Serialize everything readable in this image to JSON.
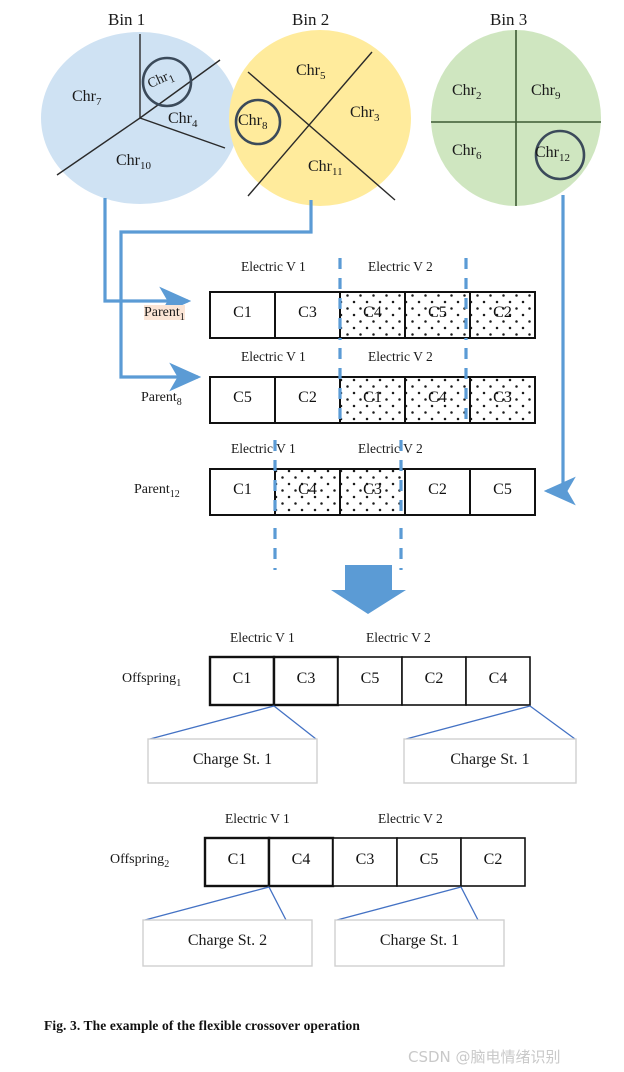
{
  "figure": {
    "caption": "Fig. 3.   The example of the flexible crossover operation",
    "watermark": "CSDN @脑电情绪识别"
  },
  "colors": {
    "bin1_fill": "#cfe2f3",
    "bin2_fill": "#ffeb9c",
    "bin3_fill": "#cfe6c0",
    "sector_line": "#2a2a2a",
    "circle_highlight": "#3b4a5a",
    "arrow_blue": "#5b9bd5",
    "dash_blue": "#5b9bd5",
    "connector_blue": "#4472c4",
    "box_border": "#111111",
    "parent_label_highlight": "#fbe5d6"
  },
  "bins": [
    {
      "name": "Bin 1",
      "shape": "pie-3-sector",
      "chromosomes": [
        {
          "label": "Chr",
          "sub": "7",
          "highlighted": false
        },
        {
          "label": "Chr",
          "sub": "1",
          "highlighted": true
        },
        {
          "label": "Chr",
          "sub": "4",
          "highlighted": false
        },
        {
          "label": "Chr",
          "sub": "10",
          "highlighted": false
        }
      ]
    },
    {
      "name": "Bin 2",
      "shape": "pie-4-sector-cross",
      "chromosomes": [
        {
          "label": "Chr",
          "sub": "5",
          "highlighted": false
        },
        {
          "label": "Chr",
          "sub": "3",
          "highlighted": false
        },
        {
          "label": "Chr",
          "sub": "8",
          "highlighted": true
        },
        {
          "label": "Chr",
          "sub": "11",
          "highlighted": false
        }
      ]
    },
    {
      "name": "Bin 3",
      "shape": "pie-4-quadrant",
      "chromosomes": [
        {
          "label": "Chr",
          "sub": "2",
          "highlighted": false
        },
        {
          "label": "Chr",
          "sub": "9",
          "highlighted": false
        },
        {
          "label": "Chr",
          "sub": "6",
          "highlighted": false
        },
        {
          "label": "Chr",
          "sub": "12",
          "highlighted": true
        }
      ]
    }
  ],
  "ev_labels": {
    "v1": "Electric V 1",
    "v2": "Electric V 2"
  },
  "parents": [
    {
      "name": "Parent",
      "sub": "1",
      "highlight_name": true,
      "cells": [
        {
          "text": "C1",
          "pattern": "plain"
        },
        {
          "text": "C3",
          "pattern": "plain"
        },
        {
          "text": "C4",
          "pattern": "dotted"
        },
        {
          "text": "C5",
          "pattern": "dotted"
        },
        {
          "text": "C2",
          "pattern": "dotted"
        }
      ]
    },
    {
      "name": "Parent",
      "sub": "8",
      "highlight_name": false,
      "cells": [
        {
          "text": "C5",
          "pattern": "plain"
        },
        {
          "text": "C2",
          "pattern": "plain"
        },
        {
          "text": "C1",
          "pattern": "dotted"
        },
        {
          "text": "C4",
          "pattern": "dotted"
        },
        {
          "text": "C3",
          "pattern": "dotted"
        }
      ]
    },
    {
      "name": "Parent",
      "sub": "12",
      "highlight_name": false,
      "cells": [
        {
          "text": "C1",
          "pattern": "plain"
        },
        {
          "text": "C4",
          "pattern": "dotted"
        },
        {
          "text": "C3",
          "pattern": "dotted"
        },
        {
          "text": "C2",
          "pattern": "plain"
        },
        {
          "text": "C5",
          "pattern": "plain"
        }
      ]
    }
  ],
  "offspring": [
    {
      "name": "Offspring",
      "sub": "1",
      "cells": [
        {
          "text": "C1"
        },
        {
          "text": "C3"
        },
        {
          "text": "C5"
        },
        {
          "text": "C2"
        },
        {
          "text": "C4"
        }
      ],
      "charge_stations": [
        {
          "text": "Charge St. 1"
        },
        {
          "text": "Charge St. 1"
        }
      ]
    },
    {
      "name": "Offspring",
      "sub": "2",
      "cells": [
        {
          "text": "C1"
        },
        {
          "text": "C4"
        },
        {
          "text": "C3"
        },
        {
          "text": "C5"
        },
        {
          "text": "C2"
        }
      ],
      "charge_stations": [
        {
          "text": "Charge St. 2"
        },
        {
          "text": "Charge St. 1"
        }
      ]
    }
  ]
}
